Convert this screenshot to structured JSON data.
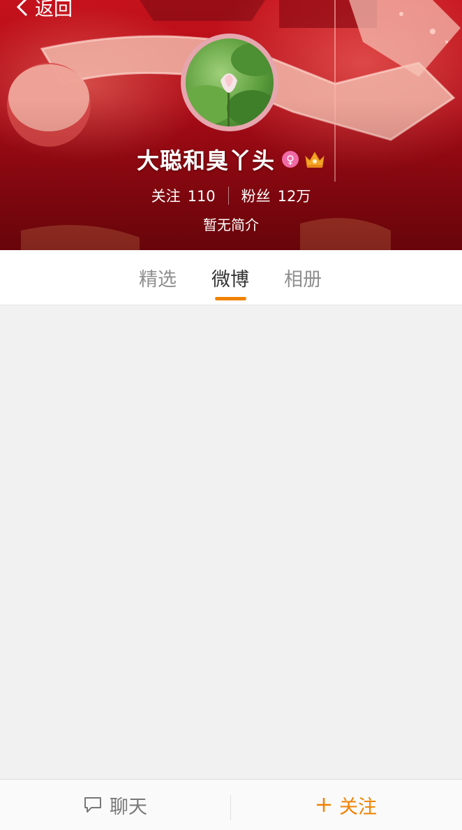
{
  "header": {
    "back_label": "返回",
    "user_name": "大聪和臭丫头",
    "gender_icon": "female-icon",
    "vip_icon": "crown-icon",
    "following_label": "关注",
    "following_count": "110",
    "followers_label": "粉丝",
    "followers_count": "12万",
    "bio": "暂无简介"
  },
  "tabs": [
    {
      "label": "精选",
      "active": false
    },
    {
      "label": "微博",
      "active": true
    },
    {
      "label": "相册",
      "active": false
    }
  ],
  "bottom_bar": {
    "chat_label": "聊天",
    "chat_icon": "chat-bubble-icon",
    "follow_label": "关注",
    "follow_icon": "plus-icon"
  },
  "colors": {
    "accent": "#f08200",
    "banner": "#b30d18",
    "gender_badge": "#f06aa6"
  }
}
